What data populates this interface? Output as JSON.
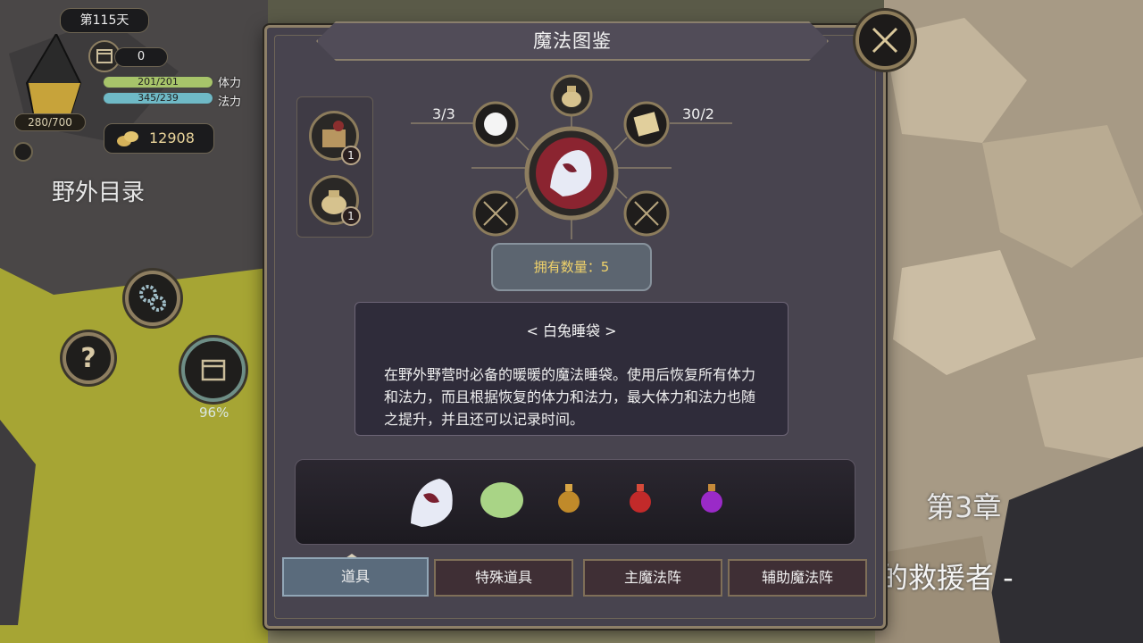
{
  "hud": {
    "day": "第115天",
    "counter": "0",
    "exp": "280/700",
    "hp": {
      "text": "201/201",
      "label": "体力",
      "fill": 1.0,
      "color": "#a7c46a"
    },
    "mp": {
      "text": "345/239",
      "label": "法力",
      "fill": 1.0,
      "color": "#6fb9c6"
    },
    "gold": "12908",
    "area_label": "野外目录",
    "progress": "96%",
    "help_glyph": "?"
  },
  "scene": {
    "chapter": "第3章",
    "subtitle": "的救援者 -"
  },
  "panel": {
    "title": "魔法图鉴",
    "list_badges": [
      "1",
      "1"
    ],
    "recipe": {
      "left_count": "3/3",
      "right_count": "30/2"
    },
    "owned": "拥有数量：5",
    "description": {
      "title": "< 白兔睡袋 >",
      "text": "在野外野营时必备的暖暖的魔法睡袋。使用后恢复所有体力和法力，而且根据恢复的体力和法力，最大体力和法力也随之提升，并且还可以记录时间。"
    },
    "tabs": [
      "道具",
      "特殊道具",
      "主魔法阵",
      "辅助魔法阵"
    ]
  },
  "colors": {
    "accent_gold": "#8e8068",
    "owned_text": "#f0d26a",
    "selected_tab": "#5a6b7c"
  }
}
